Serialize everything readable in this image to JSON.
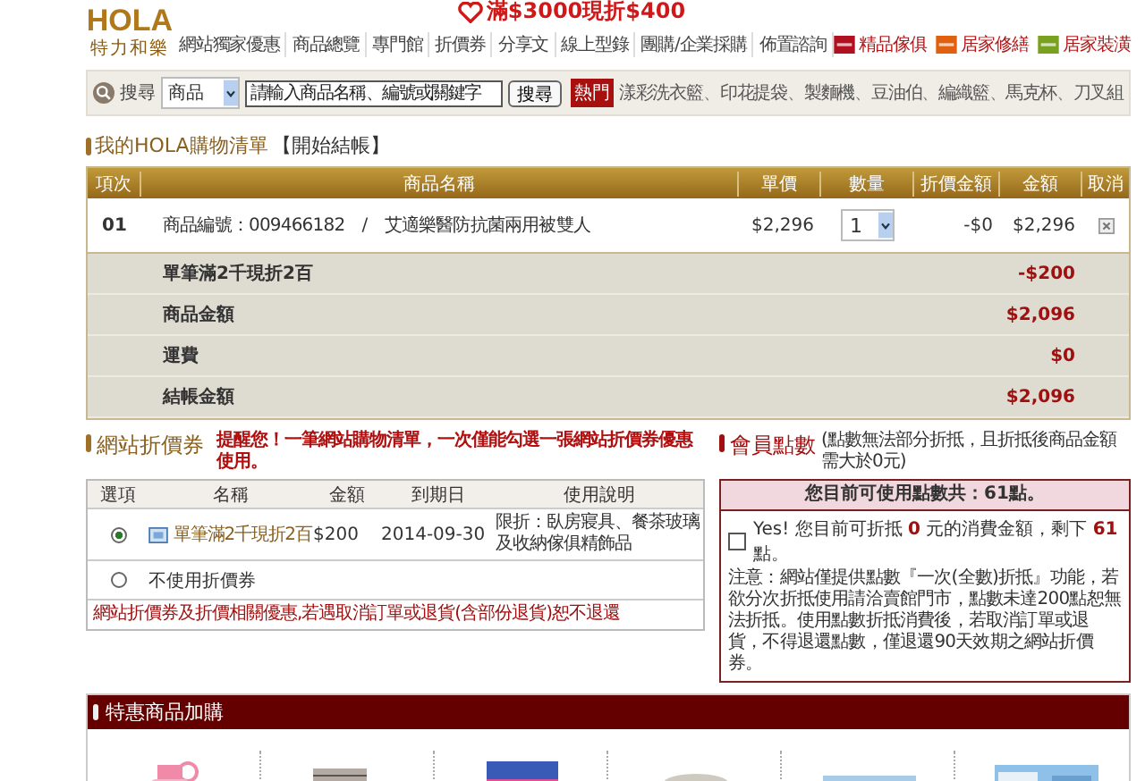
{
  "logo": {
    "brand": "HOLA",
    "name": "特力和樂"
  },
  "banner": "滿$3000現折$400",
  "nav": [
    "網站獨家優惠",
    "商品總覽",
    "專門館",
    "折價券",
    "分享文",
    "線上型錄",
    "團購/企業採購",
    "佈置諮詢"
  ],
  "brands": [
    "精品傢俱",
    "居家修繕",
    "居家裝潢"
  ],
  "search": {
    "label": "搜尋",
    "scope": "商品",
    "placeholder": "請輸入商品名稱、編號或關鍵字",
    "button": "搜尋",
    "hot_badge": "熱門",
    "separator": "、",
    "hot_keywords": [
      "漾彩洗衣籃",
      "印花提袋",
      "製麵機",
      "豆油伯",
      "編織籃",
      "馬克杯",
      "刀叉組"
    ]
  },
  "cart": {
    "title": "我的HOLA購物清單",
    "title_suffix": "【開始結帳】",
    "columns": [
      "項次",
      "商品名稱",
      "單價",
      "數量",
      "折價金額",
      "金額",
      "取消"
    ],
    "rows": [
      {
        "index": "01",
        "product": "商品編號：009466182　/　艾適樂醫防抗菌兩用被雙人",
        "price": "$2,296",
        "quantity": "1",
        "discount": "-$0",
        "amount": "$2,296"
      }
    ],
    "summary": [
      {
        "label": "單筆滿2千現折2百",
        "value": "-$200"
      },
      {
        "label": "商品金額",
        "value": "$2,096"
      },
      {
        "label": "運費",
        "value": "$0"
      },
      {
        "label": "結帳金額",
        "value": "$2,096"
      }
    ]
  },
  "coupons": {
    "title": "網站折價券",
    "note": "提醒您！一筆網站購物清單，一次僅能勾選一張網站折價券優惠使用。",
    "columns": [
      "選項",
      "名稱",
      "金額",
      "到期日",
      "使用說明"
    ],
    "rows": [
      {
        "selected": true,
        "name": "單筆滿2千現折2百",
        "amount": "$200",
        "expiry": "2014-09-30",
        "usage": "限折：臥房寢具、餐茶玻璃及收納傢俱精飾品"
      },
      {
        "selected": false,
        "name": "不使用折價券"
      }
    ],
    "footer": "網站折價券及折價相關優惠,若遇取消訂單或退貨(含部份退貨)恕不退還"
  },
  "points": {
    "title": "會員點數",
    "subtitle": "(點數無法部分折抵，且折抵後商品金額需大於0元)",
    "available": "您目前可使用點數共：61點。",
    "checked": false,
    "offer": "Yes! 您目前可折抵 **0** 元的消費金額，剩下 **61** 點。",
    "note": "注意：網站僅提供點數『一次(全數)折抵』功能，若欲分次折抵使用請洽賣館門市，點數未達200點恕無法折抵。使用點數折抵消費後，若取消訂單或退貨，不得退還點數，僅退還90天效期之網站折價券。"
  },
  "promo": {
    "title": "特惠商品加購"
  }
}
